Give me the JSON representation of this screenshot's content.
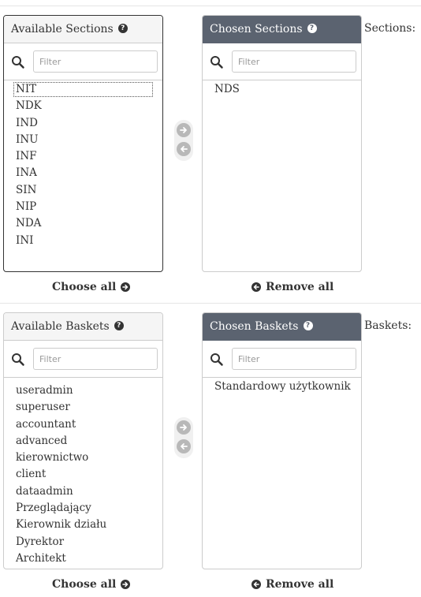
{
  "sections": {
    "available_title": "Available Sections",
    "chosen_title": "Chosen Sections",
    "side_label": "Sections:",
    "filter_placeholder": "Filter",
    "available_items": [
      "NIT",
      "NDK",
      "IND",
      "INU",
      "INF",
      "INA",
      "SIN",
      "NIP",
      "NDA",
      "INI"
    ],
    "chosen_items": [
      "NDS"
    ],
    "choose_all_label": "Choose all",
    "remove_all_label": "Remove all"
  },
  "baskets": {
    "available_title": "Available Baskets",
    "chosen_title": "Chosen Baskets",
    "side_label": "Baskets:",
    "filter_placeholder": "Filter",
    "available_items": [
      "useradmin",
      "superuser",
      "accountant",
      "advanced",
      "kierownictwo",
      "client",
      "dataadmin",
      "Przeglądający",
      "Kierownik działu",
      "Dyrektor",
      "Architekt"
    ],
    "chosen_items": [
      "Standardowy użytkownik"
    ],
    "choose_all_label": "Choose all",
    "remove_all_label": "Remove all"
  },
  "icons": {
    "help": "question-circle-icon",
    "search": "search-icon",
    "choose": "arrow-circle-right-icon",
    "remove": "arrow-circle-left-icon"
  },
  "colors": {
    "chosen_header_bg": "#5b6370",
    "available_header_bg": "#f5f5f5",
    "border": "#cccccc",
    "arrow_button": "#b8b8b8"
  }
}
